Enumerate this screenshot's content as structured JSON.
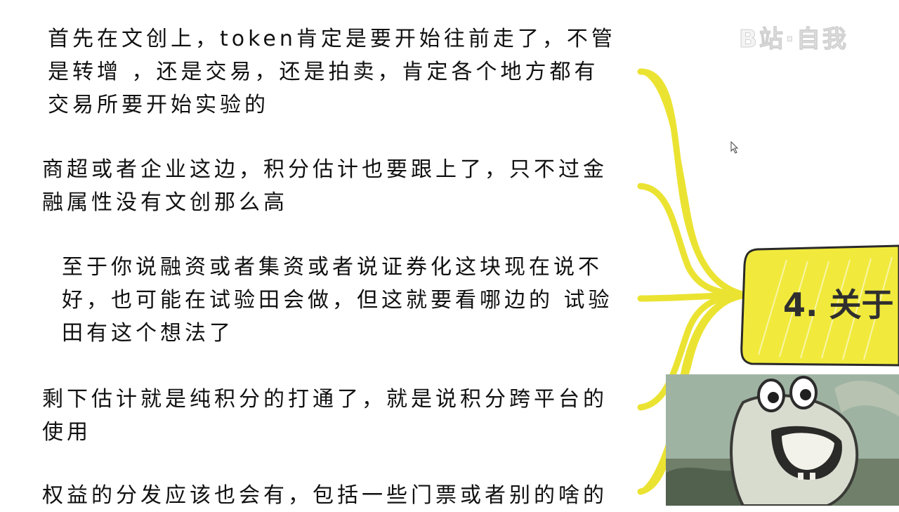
{
  "watermark": "B站·自我",
  "central_node": {
    "label": "4. 关于"
  },
  "branches": [
    {
      "lines": [
        "首先在文创上，token肯定是要开始往前走了，不管",
        "是转增 ，还是交易，还是拍卖，肯定各个地方都有",
        "交易所要开始实验的"
      ]
    },
    {
      "lines": [
        "商超或者企业这边，积分估计也要跟上了，只不过金",
        "融属性没有文创那么高"
      ]
    },
    {
      "lines": [
        "至于你说融资或者集资或者说证券化这块现在说不",
        "好，也可能在试验田会做，但这就要看哪边的 试验",
        "田有这个想法了"
      ]
    },
    {
      "lines": [
        "剩下估计就是纯积分的打通了，就是说积分跨平台的",
        "使用"
      ]
    },
    {
      "lines": [
        "权益的分发应该也会有，包括一些门票或者别的啥的"
      ]
    }
  ],
  "colors": {
    "connector": "#ebe332",
    "node_fill": "#f1ea3c",
    "node_stroke": "#2a2a2a",
    "text": "#111111",
    "inset_bg": "#9fb3a3"
  }
}
